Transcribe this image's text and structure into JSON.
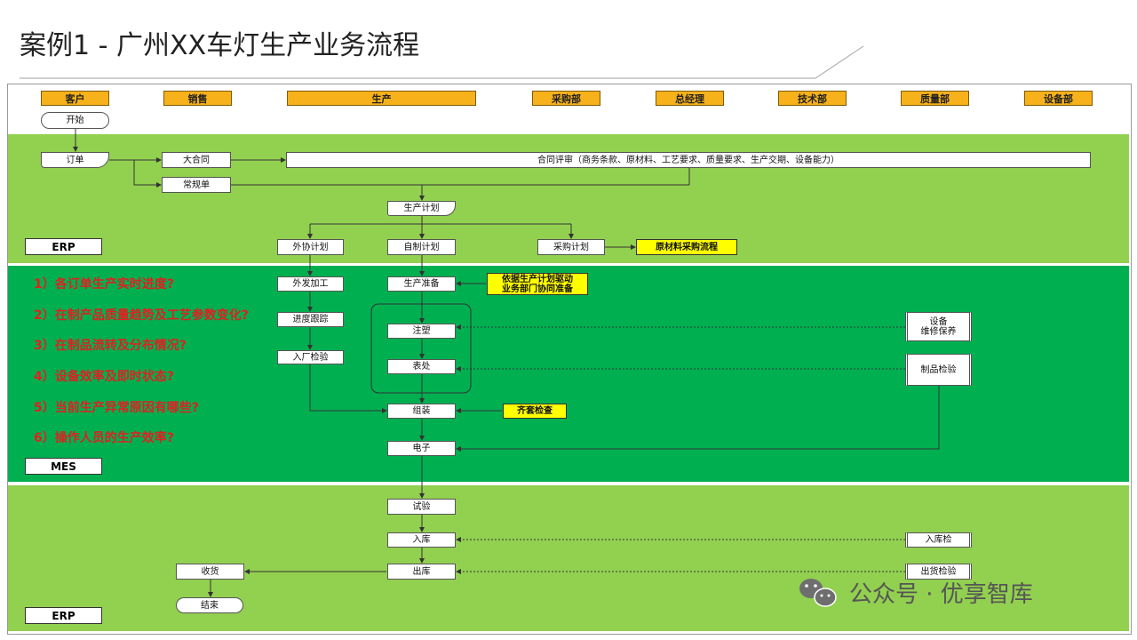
{
  "title": "案例1 - 广州XX车灯生产业务流程",
  "lanes": [
    "客户",
    "销售",
    "生产",
    "采购部",
    "总经理",
    "技术部",
    "质量部",
    "设备部"
  ],
  "nodes": {
    "start": "开始",
    "order": "订单",
    "big_contract": "大合同",
    "regular_order": "常规单",
    "contract_review": "合同评审（商务条款、原材料、工艺要求、质量要求、生产交期、设备能力）",
    "prod_plan": "生产计划",
    "outsource_plan": "外协计划",
    "self_plan": "自制计划",
    "purchase_plan": "采购计划",
    "raw_material": "原材料采购流程",
    "outsource_process": "外发加工",
    "progress_track": "进度跟踪",
    "incoming_inspect": "入厂检验",
    "prod_prep": "生产准备",
    "drive_prep_1": "依据生产计划驱动",
    "drive_prep_2": "业务部门协同准备",
    "injection": "注塑",
    "surface": "表处",
    "assembly": "组装",
    "kit_check": "齐套检查",
    "electronic": "电子",
    "equipment_1": "设备",
    "equipment_2": "维修保养",
    "product_inspect": "制品检验",
    "trial": "试验",
    "warehouse_in": "入库",
    "warehouse_in_check": "入库检",
    "warehouse_out": "出库",
    "shipment_check": "出货检验",
    "receive": "收货",
    "end": "结束"
  },
  "systems": {
    "erp_top": "ERP",
    "mes": "MES",
    "erp_bottom": "ERP"
  },
  "questions": [
    "1）各订单生产实时进度?",
    "2）在制产品质量趋势及工艺参数变化?",
    "3）在制品流转及分布情况?",
    "4）设备效率及即时状态?",
    "5）当前生产异常原因有哪些?",
    "6）操作人员的生产效率?"
  ],
  "watermark": "公众号 · 优享智库",
  "colors": {
    "light_green": "#92d050",
    "green": "#00b050",
    "lane_orange": "#f7b11b",
    "note_yellow": "#ffff00",
    "question_red": "#e02020"
  }
}
